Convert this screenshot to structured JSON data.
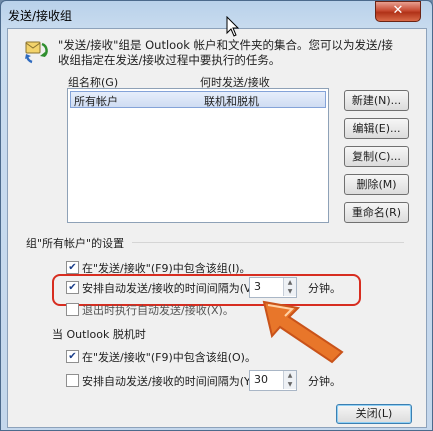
{
  "window": {
    "title": "发送/接收组",
    "close_glyph": "✕"
  },
  "description": "\"发送/接收\"组是 Outlook 帐户和文件夹的集合。您可以为发送/接收组指定在发送/接收过程中要执行的任务。",
  "group_list": {
    "col_name": "组名称(G)",
    "col_when": "何时发送/接收",
    "rows": [
      {
        "name": "所有帐户",
        "when": "联机和脱机"
      }
    ]
  },
  "buttons": {
    "new": "新建(N)...",
    "edit": "编辑(E)...",
    "copy": "复制(C)...",
    "delete": "删除(M)",
    "rename": "重命名(R)",
    "close": "关闭(L)"
  },
  "settings": {
    "section_label": "组\"所有帐户\"的设置",
    "online": {
      "include_label": "在\"发送/接收\"(F9)中包含该组(I)。",
      "include_checked": true,
      "auto_label": "安排自动发送/接收的时间间隔为(V)",
      "auto_checked": true,
      "auto_value": "3",
      "minutes": "分钟。",
      "exit_label": "退出时执行自动发送/接收(X)。"
    },
    "offline_label": "当 Outlook 脱机时",
    "offline": {
      "include_label": "在\"发送/接收\"(F9)中包含该组(O)。",
      "include_checked": true,
      "auto_label": "安排自动发送/接收的时间间隔为(Y)",
      "auto_checked": false,
      "auto_value": "30",
      "minutes": "分钟。"
    }
  },
  "colors": {
    "highlight": "#d72d20",
    "arrow": "#e8762a"
  }
}
